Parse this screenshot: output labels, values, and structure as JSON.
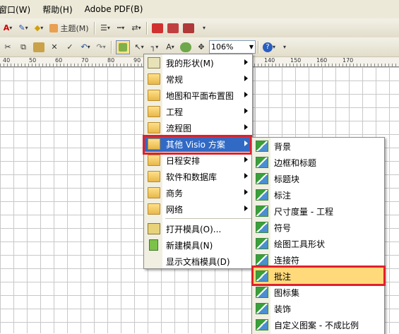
{
  "menubar": {
    "items": [
      "窗口(W)",
      "帮助(H)",
      "Adobe PDF(B)"
    ]
  },
  "toolbar1": {
    "theme_label": "主题(M)"
  },
  "toolbar2": {
    "zoom_value": "106%"
  },
  "ruler": {
    "ticks": [
      "40",
      "50",
      "60",
      "70",
      "80",
      "90",
      "100",
      "110",
      "120",
      "130",
      "140",
      "150",
      "160",
      "170"
    ]
  },
  "shapes_menu": {
    "items": [
      {
        "label": "我的形状(M)",
        "icon": "star-icon",
        "submenu": true
      },
      {
        "label": "常规",
        "icon": "folder-icon",
        "submenu": true
      },
      {
        "label": "地图和平面布置图",
        "icon": "folder-icon",
        "submenu": true
      },
      {
        "label": "工程",
        "icon": "folder-icon",
        "submenu": true
      },
      {
        "label": "流程图",
        "icon": "folder-icon",
        "submenu": true
      },
      {
        "label": "其他 Visio 方案",
        "icon": "folder-icon",
        "submenu": true
      },
      {
        "label": "日程安排",
        "icon": "folder-icon",
        "submenu": true
      },
      {
        "label": "软件和数据库",
        "icon": "folder-icon",
        "submenu": true
      },
      {
        "label": "商务",
        "icon": "folder-icon",
        "submenu": true
      },
      {
        "label": "网络",
        "icon": "folder-icon",
        "submenu": true
      }
    ],
    "footer_items": [
      {
        "label": "打开模具(O)...",
        "icon": "open-stencil-icon"
      },
      {
        "label": "新建模具(N)",
        "icon": "new-stencil-icon"
      },
      {
        "label": "显示文档模具(D)",
        "icon": "none"
      }
    ]
  },
  "visio_submenu": {
    "items": [
      "背景",
      "边框和标题",
      "标题块",
      "标注",
      "尺寸度量 - 工程",
      "符号",
      "绘图工具形状",
      "连接符",
      "批注",
      "图标集",
      "装饰",
      "自定义图案 - 不成比例"
    ]
  },
  "colors": {
    "highlight": "#316ac5",
    "red_box": "#e0202a",
    "hover": "#ffd97a"
  }
}
